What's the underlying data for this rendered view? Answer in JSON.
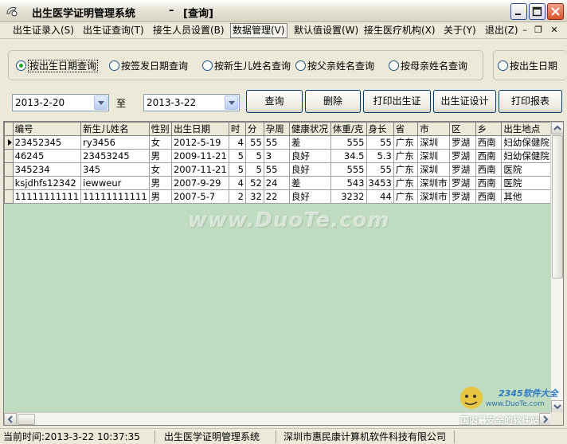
{
  "window": {
    "title": "出生医学证明管理系统",
    "separator": "–",
    "subtitle": "[查询]"
  },
  "menu": [
    {
      "label": "出生证录入(S)"
    },
    {
      "label": "出生证查询(T)"
    },
    {
      "label": "接生人员设置(B)"
    },
    {
      "label": "数据管理(V)"
    },
    {
      "label": "默认值设置(W)"
    },
    {
      "label": "接生医疗机构(X)"
    },
    {
      "label": "关于(Y)"
    },
    {
      "label": "退出(Z)"
    }
  ],
  "search_modes": [
    {
      "label": "按出生日期查询",
      "selected": true
    },
    {
      "label": "按签发日期查询",
      "selected": false
    },
    {
      "label": "按新生儿姓名查询",
      "selected": false
    },
    {
      "label": "按父亲姓名查询",
      "selected": false
    },
    {
      "label": "按母亲姓名查询",
      "selected": false
    }
  ],
  "search_mode_extra": {
    "label": "按出生日期",
    "selected": false
  },
  "date_range": {
    "from": "2013-2-20",
    "to_label": "至",
    "to": "2013-3-22"
  },
  "buttons": {
    "query": "查询",
    "delete": "删除",
    "print_cert": "打印出生证",
    "cert_design": "出生证设计",
    "print_report": "打印报表"
  },
  "table": {
    "columns": [
      "编号",
      "新生儿姓名",
      "性别",
      "出生日期",
      "时",
      "分",
      "孕周",
      "健康状况",
      "体重/克",
      "身长",
      "省",
      "市",
      "区",
      "乡",
      "出生地点"
    ],
    "rows": [
      [
        "23452345",
        "ry3456",
        "女",
        "2012-5-19",
        "4",
        "55",
        "55",
        "差",
        "555",
        "55",
        "广东",
        "深圳",
        "罗湖",
        "西南",
        "妇幼保健院"
      ],
      [
        "46245",
        "23453245",
        "男",
        "2009-11-21",
        "5",
        "5",
        "3",
        "良好",
        "34.5",
        "5.3",
        "广东",
        "深圳",
        "罗湖",
        "西南",
        "妇幼保健院"
      ],
      [
        "345234",
        "345",
        "女",
        "2007-11-21",
        "5",
        "5",
        "55",
        "良好",
        "555",
        "55",
        "广东",
        "深圳",
        "罗湖",
        "西南",
        "医院"
      ],
      [
        "ksjdhfs12342",
        "iewweur",
        "男",
        "2007-9-29",
        "4",
        "52",
        "24",
        "差",
        "543",
        "3453",
        "广东",
        "深圳市",
        "罗湖",
        "西南",
        "医院"
      ],
      [
        "11111111111",
        "11111111111",
        "男",
        "2007-5-7",
        "2",
        "32",
        "22",
        "良好",
        "3232",
        "44",
        "广东",
        "深圳市",
        "罗湖",
        "西南",
        "其他"
      ]
    ]
  },
  "watermark": {
    "site": "www.DuoTe.com",
    "logo_text": "2345软件大全",
    "logo_url": "www.DuoTe.com",
    "logo_tagline": "国内最安全的软件站"
  },
  "status": {
    "time": "当前时间:2013-3-22 10:37:35",
    "app": "出生医学证明管理系统",
    "company": "深圳市惠民康计算机软件科技有限公司"
  }
}
